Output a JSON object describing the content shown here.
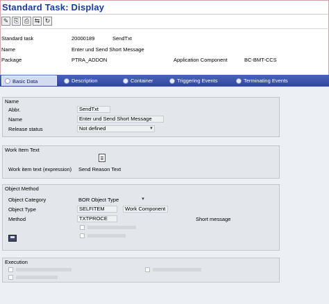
{
  "window": {
    "title": "Standard Task: Display"
  },
  "toolbar": {
    "buttons": [
      {
        "icon": "edit-icon",
        "glyph": "✎"
      },
      {
        "icon": "other-object-icon",
        "glyph": "⎘"
      },
      {
        "icon": "print-icon",
        "glyph": "⎙"
      },
      {
        "icon": "goto-icon",
        "glyph": "⇆"
      },
      {
        "icon": "refresh-icon",
        "glyph": "↻"
      }
    ]
  },
  "header": {
    "standard_task_label": "Standard task",
    "standard_task_value": "20000189",
    "standard_task_abbr": "SendTxt",
    "name_label": "Name",
    "name_value": "Enter und Send Short Message",
    "package_label": "Package",
    "package_value": "PTRA_ADDON",
    "app_component_label": "Application Component",
    "app_component_value": "BC-BMT-CCS"
  },
  "tabs": [
    {
      "label": "Basic Data",
      "active": true
    },
    {
      "label": "Description",
      "active": false
    },
    {
      "label": "Container",
      "active": false
    },
    {
      "label": "Triggering Events",
      "active": false
    },
    {
      "label": "Terminating Events",
      "active": false
    }
  ],
  "name_group": {
    "title": "Name",
    "abbr_label": "Abbr.",
    "abbr_value": "SendTxt",
    "name_label": "Name",
    "name_value": "Enter und Send Short Message",
    "release_label": "Release status",
    "release_value": "Not defined"
  },
  "workitem_group": {
    "title": "Work Item Text",
    "workitem_label": "Work item text (expression)",
    "workitem_value": "Send Reason Text"
  },
  "object_group": {
    "title": "Object Method",
    "category_label": "Object Category",
    "category_value": "BOR Object Type",
    "type_label": "Object Type",
    "type_value": "SELFITEM",
    "type_extra": "Work Component",
    "method_label": "Method",
    "method_value": "TXTPROCE",
    "method_extra": "Short message"
  },
  "execution_group": {
    "title": "Execution"
  },
  "colors": {
    "title": "#1a3a9c",
    "tabstrip": "#2e469c",
    "active_tab": "#d2dbef"
  }
}
